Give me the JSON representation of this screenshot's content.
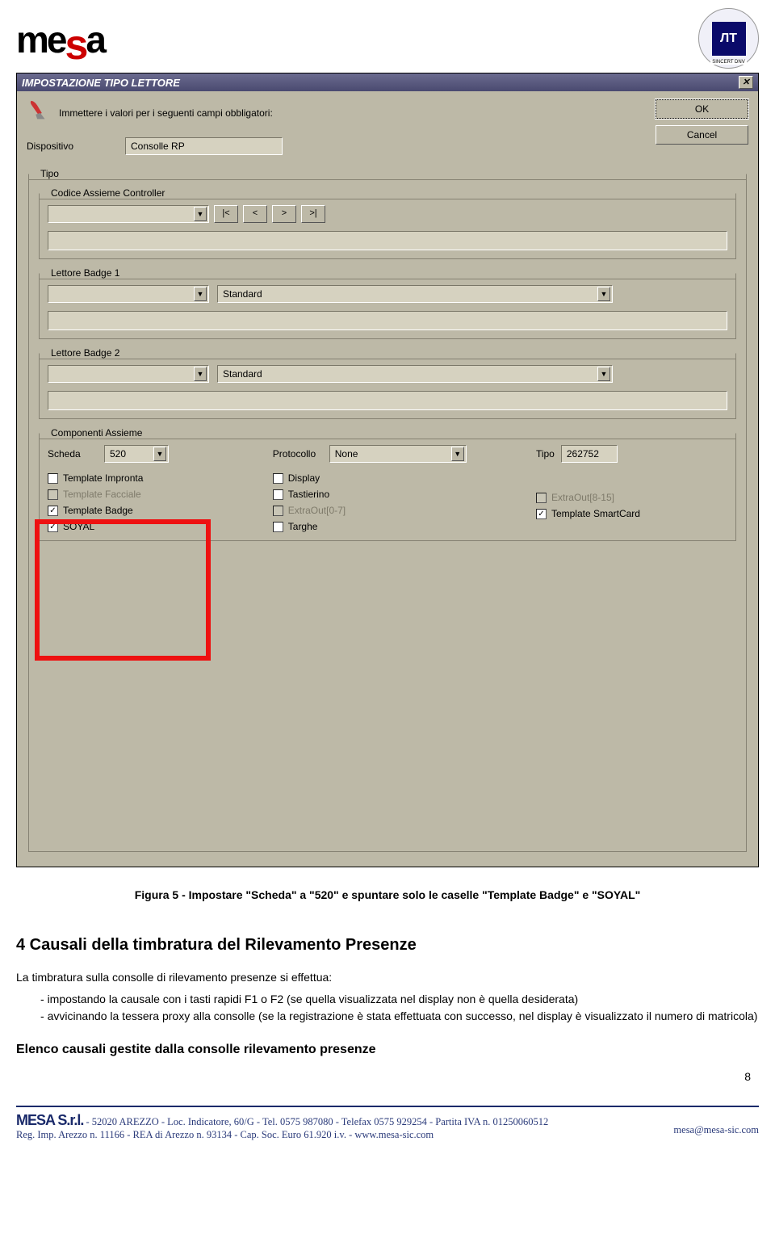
{
  "header": {
    "logo_text": "mesa",
    "cert_inner": "ЛТ",
    "cert_label": "SINCERT DNV"
  },
  "dialog": {
    "title": "IMPOSTAZIONE TIPO LETTORE",
    "close_glyph": "✕",
    "intro": "Immettere i valori per i seguenti campi obbligatori:",
    "device_label": "Dispositivo",
    "device_value": "Consolle RP",
    "ok_label": "OK",
    "cancel_label": "Cancel",
    "group_tipo": "Tipo",
    "group_codice": "Codice Assieme Controller",
    "nav": {
      "first": "|<",
      "prev": "<",
      "next": ">",
      "last": ">|"
    },
    "group_badge1": "Lettore Badge 1",
    "group_badge2": "Lettore Badge 2",
    "badge_type_value": "Standard",
    "group_comp": "Componenti Assieme",
    "scheda_label": "Scheda",
    "scheda_value": "520",
    "protocollo_label": "Protocollo",
    "protocollo_value": "None",
    "tipo_label": "Tipo",
    "tipo_value": "262752",
    "checks": {
      "template_impronta": "Template Impronta",
      "template_facciale": "Template Facciale",
      "template_badge": "Template Badge",
      "soyal": "SOYAL",
      "display": "Display",
      "tastierino": "Tastierino",
      "extra07": "ExtraOut[0-7]",
      "targhe": "Targhe",
      "extra815": "ExtraOut[8-15]",
      "template_smartcard": "Template SmartCard"
    }
  },
  "caption": "Figura 5 - Impostare \"Scheda\" a \"520\" e spuntare solo le caselle \"Template Badge\" e \"SOYAL\"",
  "section": {
    "title": "4 Causali della timbratura del Rilevamento Presenze",
    "intro": "La timbratura sulla consolle di rilevamento presenze si effettua:",
    "bullets": [
      "impostando la causale con i tasti rapidi F1 o F2 (se quella visualizzata nel display non è quella desiderata)",
      "avvicinando la tessera proxy alla consolle (se la registrazione è stata effettuata con successo, nel display è visualizzato il numero di matricola)"
    ],
    "subtitle": "Elenco causali gestite dalla consolle rilevamento presenze"
  },
  "page_number": "8",
  "footer": {
    "name": "MESA S.r.l.",
    "line1": "- 52020 AREZZO - Loc. Indicatore, 60/G - Tel. 0575 987080 - Telefax 0575 929254 - Partita IVA n. 01250060512",
    "line2": "Reg. Imp. Arezzo n. 11166 - REA di Arezzo n. 93134 - Cap. Soc. Euro 61.920 i.v. - www.mesa-sic.com",
    "email": "mesa@mesa-sic.com"
  }
}
